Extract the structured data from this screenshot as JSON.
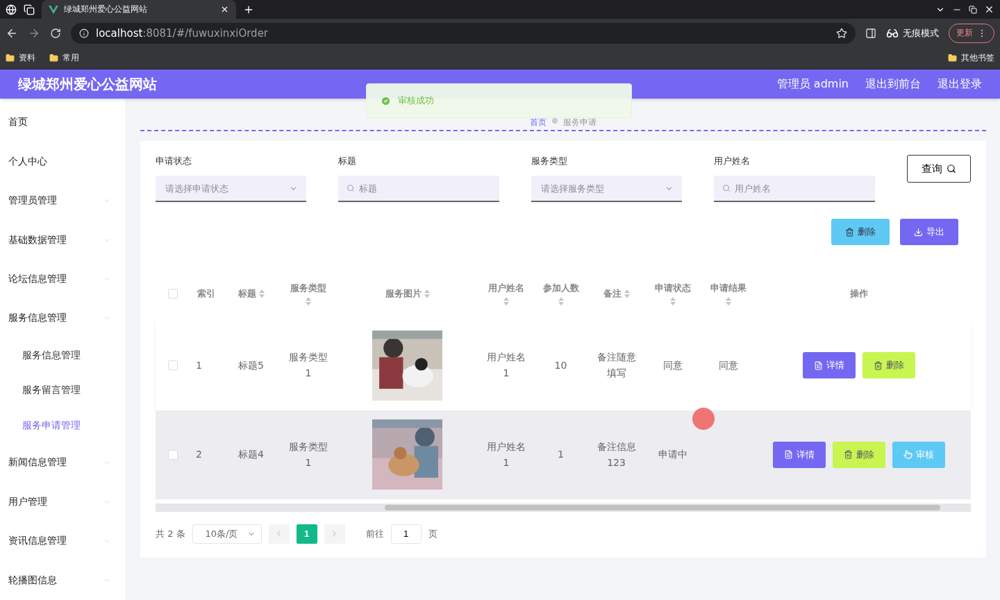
{
  "browser": {
    "tab_title": "绿城郑州爱心公益网站",
    "url_host": "localhost",
    "url_path": ":8081/#/fuwuxinxiOrder",
    "profile": "无痕模式",
    "update": "更新",
    "bookmarks": [
      "资料",
      "常用"
    ],
    "other_bookmarks": "其他书签"
  },
  "header": {
    "site_title": "绿城郑州爱心公益网站",
    "links": [
      "管理员 admin",
      "退出到前台",
      "退出登录"
    ]
  },
  "toast": {
    "kind": "success",
    "message": "审核成功"
  },
  "sidebar": {
    "items": [
      {
        "label": "首页",
        "kind": "link",
        "selected": false
      },
      {
        "label": "个人中心",
        "kind": "link",
        "selected": false
      },
      {
        "label": "管理员管理",
        "kind": "submenu",
        "expanded": false,
        "selected": false
      },
      {
        "label": "基础数据管理",
        "kind": "submenu",
        "expanded": false,
        "selected": false
      },
      {
        "label": "论坛信息管理",
        "kind": "submenu",
        "expanded": false,
        "selected": false
      },
      {
        "label": "服务信息管理",
        "kind": "submenu",
        "expanded": true,
        "selected": false,
        "children": [
          {
            "label": "服务信息管理",
            "selected": false
          },
          {
            "label": "服务留言管理",
            "selected": false
          },
          {
            "label": "服务申请管理",
            "selected": true
          }
        ]
      },
      {
        "label": "新闻信息管理",
        "kind": "submenu",
        "expanded": false,
        "selected": false
      },
      {
        "label": "用户管理",
        "kind": "submenu",
        "expanded": false,
        "selected": false
      },
      {
        "label": "资讯信息管理",
        "kind": "submenu",
        "expanded": false,
        "selected": false
      },
      {
        "label": "轮播图信息",
        "kind": "submenu",
        "expanded": false,
        "selected": false
      }
    ]
  },
  "breadcrumb": [
    "首页",
    "服务申请"
  ],
  "filters": [
    {
      "label": "申请状态",
      "kind": "select",
      "placeholder": "请选择申请状态"
    },
    {
      "label": "标题",
      "kind": "input",
      "placeholder": "标题"
    },
    {
      "label": "服务类型",
      "kind": "select",
      "placeholder": "请选择服务类型"
    },
    {
      "label": "用户姓名",
      "kind": "input",
      "placeholder": "用户姓名"
    }
  ],
  "search_button": "查询",
  "toolbar_buttons": [
    {
      "label": "删除",
      "kind": "delete"
    },
    {
      "label": "导出",
      "kind": "export"
    }
  ],
  "table": {
    "select_all_checked": false,
    "columns": [
      {
        "label": "索引",
        "sortable": false
      },
      {
        "label": "标题",
        "sortable": true
      },
      {
        "label": "服务类型",
        "sortable": true
      },
      {
        "label": "服务图片",
        "sortable": true
      },
      {
        "label": "用户姓名",
        "sortable": true
      },
      {
        "label": "参加人数",
        "sortable": true
      },
      {
        "label": "备注",
        "sortable": true
      },
      {
        "label": "申请状态",
        "sortable": true
      },
      {
        "label": "申请结果",
        "sortable": true
      },
      {
        "label": "操作",
        "sortable": false
      }
    ],
    "rows": [
      {
        "checked": false,
        "highlighted": false,
        "index": "1",
        "title": "标题5",
        "service_type": "服务类型\n1",
        "image": {
          "kind": "picture"
        },
        "user_name": "用户姓名\n1",
        "participants": "10",
        "remark": "备注随意填写",
        "status": "同意",
        "result": "同意",
        "actions": [
          {
            "label": "详情",
            "kind": "detail"
          },
          {
            "label": "删除",
            "kind": "delete"
          }
        ]
      },
      {
        "checked": false,
        "highlighted": true,
        "index": "2",
        "title": "标题4",
        "service_type": "服务类型\n1",
        "image": {
          "kind": "picture"
        },
        "user_name": "用户姓名\n1",
        "participants": "1",
        "remark": "备注信息\n123",
        "status": "申请中",
        "actions": [
          {
            "label": "详情",
            "kind": "detail"
          },
          {
            "label": "删除",
            "kind": "delete"
          },
          {
            "label": "审核",
            "kind": "review"
          }
        ]
      }
    ]
  },
  "pagination": {
    "total": "共 2 条",
    "page_size": "10条/页",
    "pages": [
      {
        "label": "1",
        "selected": true
      }
    ],
    "goto_label": "前往",
    "goto_value": "1",
    "goto_suffix": "页"
  }
}
